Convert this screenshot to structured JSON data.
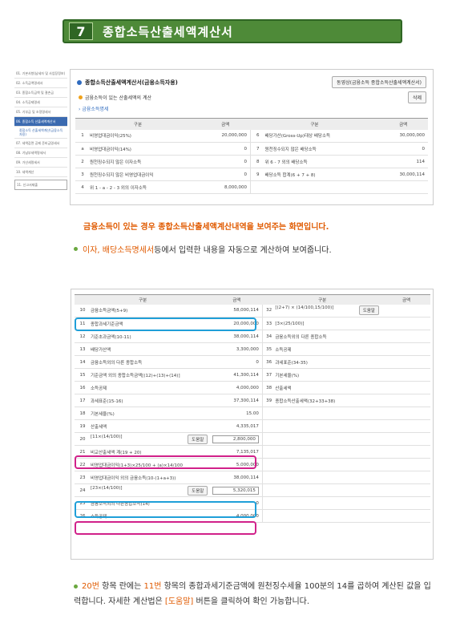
{
  "banner": {
    "number": "7",
    "title": "종합소득산출세액계산서"
  },
  "leftnav": {
    "items": [
      "01. 기본사항(납세자 및 사업장정보)",
      "02. 소득금액명세서",
      "03. 종합소득금액 및 결손금",
      "04. 소득공제명세",
      "05. 기부금 및 조정명세서",
      "06. 종합소득 산출세액계산서",
      "07. 세액감면 공제 준비금명세서",
      "08. 기납부세액명세서",
      "09. 가산세명세서",
      "10. 세액계산",
      "11. 신고서제출"
    ],
    "sub": "종합소득 산출세액계산(금융소득자용)"
  },
  "panel1": {
    "title": "종합소득산출세액계산서(금융소득자용)",
    "equal_btn": "동영상(금융소득 종합소득산출세액계산서)",
    "sub_label": "금융소득이 있는 산출세액의 계산",
    "delete_btn": "삭제",
    "link": "금융소득명세",
    "headers": [
      "구분",
      "금액",
      "구분",
      "금액"
    ],
    "rows": [
      {
        "no": "1",
        "label": "비영업대금이익(25%)",
        "amt": "20,000,000",
        "no2": "6",
        "label2": "배당가산(Gross-Up)대상 배당소득",
        "amt2": "30,000,000"
      },
      {
        "no": "a",
        "label": "비영업대금이익(14%)",
        "amt": "0",
        "no2": "7",
        "label2": "원천징수되지 않은 배당소득",
        "amt2": "0"
      },
      {
        "no": "2",
        "label": "원천징수되지 않은 이자소득",
        "amt": "0",
        "no2": "8",
        "label2": "위 6 - 7 외의 배당소득",
        "amt2": "114"
      },
      {
        "no": "3",
        "label": "원천징수되지 않은 비영업대금이익",
        "amt": "0",
        "no2": "9",
        "label2": "배당소득 합계(6 + 7 + 8)",
        "amt2": "30,000,114"
      },
      {
        "no": "4",
        "label": "위 1 - a - 2 - 3 외의 이자소득",
        "amt": "8,000,000",
        "no2": "",
        "label2": "",
        "amt2": ""
      }
    ]
  },
  "desc1": "금융소득이 있는 경우 종합소득산출세액계산내역을 보여주는 화면입니다.",
  "desc2": {
    "hl": "이자, 배당소득명세서",
    "rest": " 등에서 입력한 내용을 자동으로 계산하여 보여줍니다."
  },
  "panel2": {
    "headers": [
      "구분",
      "금액",
      "구분",
      "금액"
    ],
    "help_btn": "도움말",
    "rows": [
      {
        "no": "10",
        "label": "금융소득금액(5+9)",
        "amt": "58,000,114",
        "no2": "32",
        "label2": "[(2+7) × (14/100,15/100)]",
        "help2": true
      },
      {
        "no": "11",
        "label": "종합과세기준금액",
        "amt": "20,000,000",
        "no2": "33",
        "label2": "[3×(25/100)]"
      },
      {
        "no": "12",
        "label": "기준초과금액(10-11)",
        "amt": "38,000,114",
        "no2": "34",
        "label2": "금융소득외의 다른 종합소득"
      },
      {
        "no": "13",
        "label": "배당가산액",
        "amt": "3,300,000",
        "no2": "35",
        "label2": "소득공제"
      },
      {
        "no": "14",
        "label": "금융소득외의 다른 종합소득",
        "amt": "0",
        "no2": "36",
        "label2": "과세표준(34-35)"
      },
      {
        "no": "15",
        "label": "기준금액 외의 종합소득금액[(12)+(13)+(14)]",
        "amt": "41,300,114",
        "no2": "37",
        "label2": "기본세율(%)"
      },
      {
        "no": "16",
        "label": "소득공제",
        "amt": "4,000,000",
        "no2": "38",
        "label2": "산출세액"
      },
      {
        "no": "17",
        "label": "과세표준(15-16)",
        "amt": "37,300,114",
        "no2": "39",
        "label2": "종합소득산출세액(32+33+38)"
      },
      {
        "no": "18",
        "label": "기본세율(%)",
        "amt": "15.00",
        "no2": "",
        "label2": ""
      },
      {
        "no": "19",
        "label": "산출세액",
        "amt": "4,335,017",
        "no2": "",
        "label2": ""
      },
      {
        "no": "20",
        "label": "[11×(14/100)]",
        "amt": "2,800,000",
        "help": true,
        "no2": "",
        "label2": ""
      },
      {
        "no": "21",
        "label": "비교산출세액 계(19 + 20)",
        "amt": "7,135,017",
        "no2": "",
        "label2": ""
      },
      {
        "no": "22",
        "label": "비영업대금이익(1+3)×25/100 + (a)×14/100",
        "amt": "5,000,000",
        "no2": "",
        "label2": ""
      },
      {
        "no": "23",
        "label": "비영업대금이익 외의 금융소득(10-(1+a+3))",
        "amt": "38,000,114",
        "no2": "",
        "label2": ""
      },
      {
        "no": "24",
        "label": "[23×(14/100)]",
        "amt": "5,320,015",
        "help": true,
        "no2": "",
        "label2": ""
      },
      {
        "no": "25",
        "label": "금융소득외의 다른종합소득(14)",
        "amt": "0",
        "no2": "",
        "label2": ""
      },
      {
        "no": "26",
        "label": "소득공제",
        "amt": "4,000,000",
        "no2": "",
        "label2": ""
      }
    ]
  },
  "desc3": {
    "p1": "20번",
    "p2": " 항목 란에는 ",
    "p3": "11번",
    "p4": " 항목의 종합과세기준금액에 원천징수세율 100분의 14를 곱하여 계산된 값을 입력합니다. 자세한 계산법은 ",
    "p5": "[도움말]",
    "p6": " 버튼을 클릭하여 확인 가능합니다."
  }
}
